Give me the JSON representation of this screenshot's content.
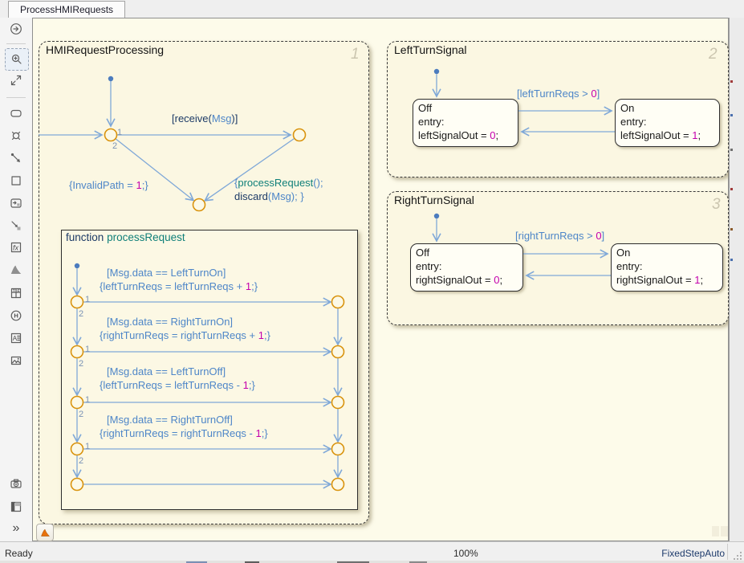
{
  "window": {
    "tab_title": "ProcessHMIRequests"
  },
  "statusbar": {
    "status": "Ready",
    "zoom": "100%",
    "solver": "FixedStepAuto"
  },
  "toolbar": {
    "glyphs": {
      "fx": "fx",
      "history": "H",
      "annotation": "A",
      "truth_t": "T",
      "truth_f": "F",
      "more": "»"
    }
  },
  "colors": {
    "canvas_bg": "#FDFBEA",
    "chart_bg": "#FBF7E2",
    "state_bg": "#FFFEF5",
    "wire_blue": "#7FA8D8",
    "junction_orange": "#D9930D",
    "label_blue": "#4E86C8",
    "keyword_navy": "#1C3A66",
    "function_teal": "#0F7F79",
    "literal_magenta": "#C400AC"
  },
  "hmi": {
    "title": "HMIRequestProcessing",
    "badge": "1",
    "order": {
      "first": "1",
      "second": "2"
    },
    "t_receive": [
      "[receive(",
      "Msg",
      ")]"
    ],
    "t_invalid": [
      "{InvalidPath = ",
      "1",
      ";}"
    ],
    "t_process_l1": [
      "{",
      "processRequest",
      "();"
    ],
    "t_process_l2": [
      "discard",
      "(Msg); }"
    ],
    "func": {
      "keyword": "function",
      "name": "processRequest",
      "rows": [
        {
          "cond": "[Msg.data == LeftTurnOn]",
          "act": [
            "{leftTurnReqs = leftTurnReqs + ",
            "1",
            ";}"
          ]
        },
        {
          "cond": "[Msg.data == RightTurnOn]",
          "act": [
            "{rightTurnReqs = rightTurnReqs + ",
            "1",
            ";}"
          ]
        },
        {
          "cond": "[Msg.data == LeftTurnOff]",
          "act": [
            "{leftTurnReqs = leftTurnReqs - ",
            "1",
            ";}"
          ]
        },
        {
          "cond": "[Msg.data == RightTurnOff]",
          "act": [
            "{rightTurnReqs = rightTurnReqs - ",
            "1",
            ";}"
          ]
        }
      ]
    }
  },
  "left_turn": {
    "title": "LeftTurnSignal",
    "badge": "2",
    "cond": [
      "[leftTurnReqs > ",
      "0",
      "]"
    ],
    "off": {
      "name": "Off",
      "entry": "entry:",
      "act": [
        "leftSignalOut = ",
        "0",
        ";"
      ]
    },
    "on": {
      "name": "On",
      "entry": "entry:",
      "act": [
        "leftSignalOut = ",
        "1",
        ";"
      ]
    }
  },
  "right_turn": {
    "title": "RightTurnSignal",
    "badge": "3",
    "cond": [
      "[rightTurnReqs > ",
      "0",
      "]"
    ],
    "off": {
      "name": "Off",
      "entry": "entry:",
      "act": [
        "rightSignalOut = ",
        "0",
        ";"
      ]
    },
    "on": {
      "name": "On",
      "entry": "entry:",
      "act": [
        "rightSignalOut = ",
        "1",
        ";"
      ]
    }
  }
}
